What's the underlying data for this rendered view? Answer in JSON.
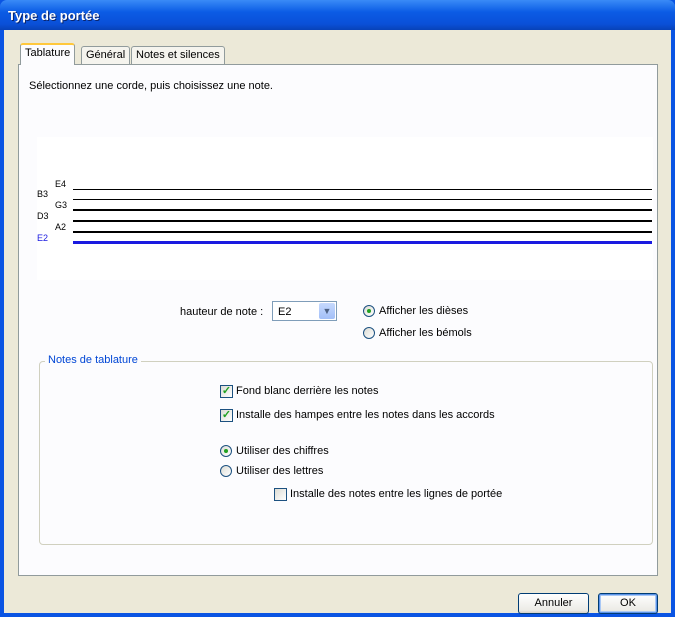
{
  "window": {
    "title": "Type de portée"
  },
  "tabs": [
    {
      "label": "Tablature",
      "active": true
    },
    {
      "label": "Général",
      "active": false
    },
    {
      "label": "Notes et silences",
      "active": false
    }
  ],
  "tablature": {
    "instruction": "Sélectionnez une corde, puis choisissez une note.",
    "strings": [
      {
        "label": "E4",
        "selected": false
      },
      {
        "label": "B3",
        "selected": false
      },
      {
        "label": "G3",
        "selected": false
      },
      {
        "label": "D3",
        "selected": false
      },
      {
        "label": "A2",
        "selected": false
      },
      {
        "label": "E2",
        "selected": true
      }
    ],
    "selected_string_color": "#1A1AE0",
    "pitch_label": "hauteur de note :",
    "pitch_value": "E2",
    "show_sharps_label": "Afficher les dièses",
    "show_sharps_selected": true,
    "show_flats_label": "Afficher les bémols",
    "show_flats_selected": false
  },
  "tab_notes": {
    "title": "Notes de tablature",
    "white_bg_label": "Fond blanc derrière les notes",
    "white_bg_checked": true,
    "stems_label": "Installe des hampes entre les notes dans les accords",
    "stems_checked": true,
    "use_numbers_label": "Utiliser des chiffres",
    "use_numbers_selected": true,
    "use_letters_label": "Utiliser des lettres",
    "use_letters_selected": false,
    "between_lines_label": "Installe des notes entre les lignes de portée",
    "between_lines_checked": false
  },
  "buttons": {
    "cancel": "Annuler",
    "ok": "OK"
  },
  "icons": {
    "dropdown": "chevron-down-icon",
    "check": "checkmark-icon"
  }
}
